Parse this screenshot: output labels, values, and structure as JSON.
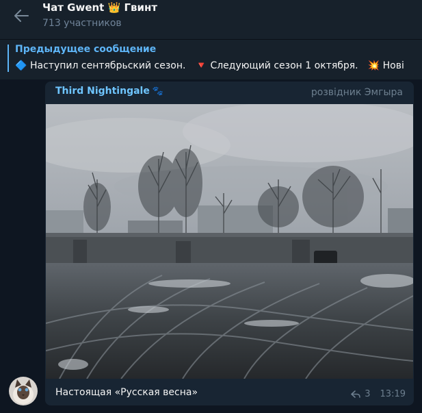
{
  "header": {
    "title": "Чат Gwent 👑 Гвинт",
    "members": "713 участников",
    "back_icon": "arrow-left-icon"
  },
  "pinned": {
    "label": "Предыдущее сообщение",
    "items": [
      {
        "icon": "🔷",
        "text": "Наступил сентябрьский сезон."
      },
      {
        "icon": "🔻",
        "text": "Следующий сезон 1 октября."
      },
      {
        "icon": "💥",
        "text": "Нові"
      }
    ]
  },
  "message": {
    "author": "Third Nightingale",
    "author_badge": "🐾",
    "author_rank": "розвідник Эмгыра",
    "caption": "Настоящая «Русская весна»",
    "reply_count": "3",
    "time": "13:19"
  },
  "colors": {
    "background": "#0e1621",
    "header": "#17212b",
    "bubble": "#182533",
    "accent": "#5eb5f7",
    "author": "#6fc5ff"
  }
}
